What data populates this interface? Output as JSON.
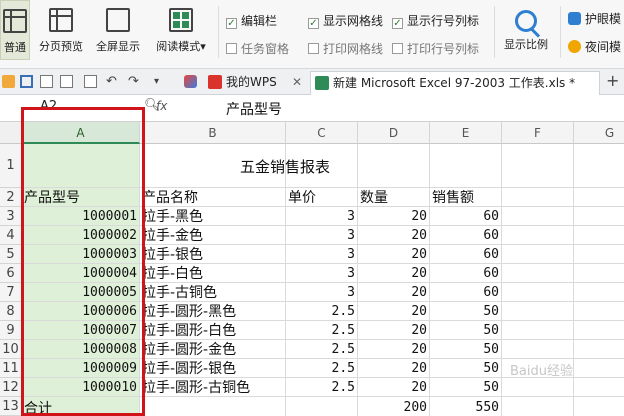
{
  "ribbon": {
    "view_buttons": [
      "普通",
      "分页预览",
      "全屏显示",
      "阅读模式"
    ],
    "checkboxes_row1": [
      {
        "label": "编辑栏",
        "checked": true
      },
      {
        "label": "显示网格线",
        "checked": true
      },
      {
        "label": "显示行号列标",
        "checked": true
      }
    ],
    "checkboxes_row2": [
      {
        "label": "任务窗格",
        "checked": false
      },
      {
        "label": "打印网格线",
        "checked": false
      },
      {
        "label": "打印行号列标",
        "checked": false
      }
    ],
    "zoom_label": "显示比例",
    "eye_label": "护眼模",
    "night_label": "夜间模"
  },
  "tabs": [
    {
      "label": "我的WPS"
    },
    {
      "label": "新建 Microsoft Excel 97-2003 工作表.xls *"
    }
  ],
  "formula_bar": {
    "name_box": "A2",
    "fx": "fx",
    "content": "产品型号"
  },
  "sheet": {
    "columns": [
      "A",
      "B",
      "C",
      "D",
      "E",
      "F",
      "G"
    ],
    "row_numbers": [
      "1",
      "2",
      "3",
      "4",
      "5",
      "6",
      "7",
      "8",
      "9",
      "10",
      "11",
      "12",
      "13"
    ],
    "title": "五金销售报表",
    "headers": [
      "产品型号",
      "产品名称",
      "单价",
      "数量",
      "销售额"
    ],
    "rows": [
      [
        "1000001",
        "拉手-黑色",
        "3",
        "20",
        "60"
      ],
      [
        "1000002",
        "拉手-金色",
        "3",
        "20",
        "60"
      ],
      [
        "1000003",
        "拉手-银色",
        "3",
        "20",
        "60"
      ],
      [
        "1000004",
        "拉手-白色",
        "3",
        "20",
        "60"
      ],
      [
        "1000005",
        "拉手-古铜色",
        "3",
        "20",
        "60"
      ],
      [
        "1000006",
        "拉手-圆形-黑色",
        "2.5",
        "20",
        "50"
      ],
      [
        "1000007",
        "拉手-圆形-白色",
        "2.5",
        "20",
        "50"
      ],
      [
        "1000008",
        "拉手-圆形-金色",
        "2.5",
        "20",
        "50"
      ],
      [
        "1000009",
        "拉手-圆形-银色",
        "2.5",
        "20",
        "50"
      ],
      [
        "1000010",
        "拉手-圆形-古铜色",
        "2.5",
        "20",
        "50"
      ]
    ],
    "total_label": "合计",
    "total_qty": "200",
    "total_sales": "550"
  },
  "watermark": "Baidu经验",
  "colors": {
    "selection_green": "#dff0d8",
    "highlight_red": "#d0141a"
  }
}
